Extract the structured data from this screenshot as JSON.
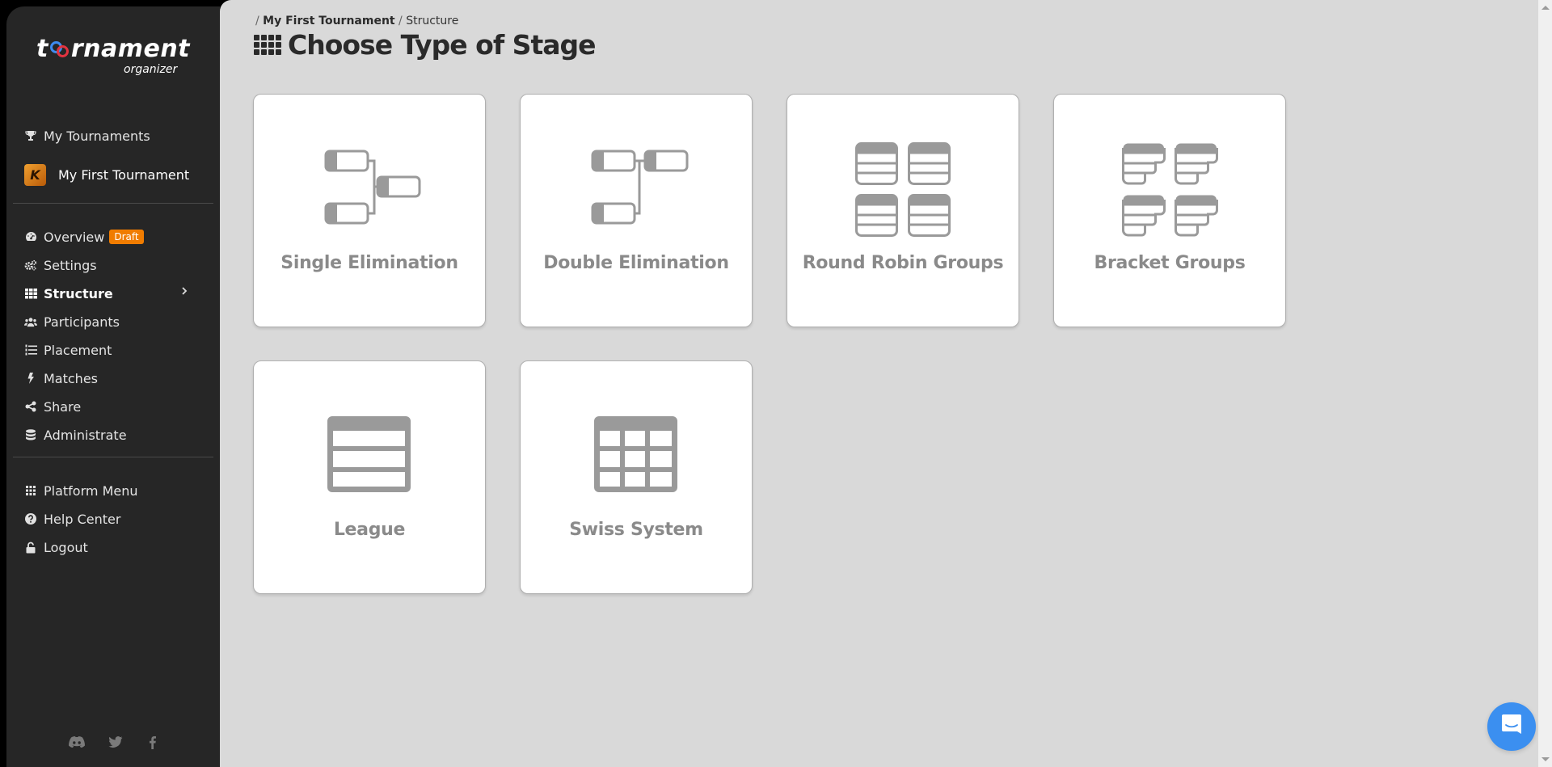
{
  "app": {
    "logo_main_left": "t",
    "logo_main_right": "rnament",
    "logo_sub": "organizer"
  },
  "sidebar": {
    "my_tournaments": "My Tournaments",
    "current_tournament": "My First Tournament",
    "tournament_avatar_glyph": "K",
    "items": [
      {
        "label": "Overview",
        "icon": "dashboard-icon",
        "badge": "Draft"
      },
      {
        "label": "Settings",
        "icon": "gears-icon"
      },
      {
        "label": "Structure",
        "icon": "grid-icon",
        "active": true
      },
      {
        "label": "Participants",
        "icon": "users-icon"
      },
      {
        "label": "Placement",
        "icon": "ordered-list-icon"
      },
      {
        "label": "Matches",
        "icon": "bolt-icon"
      },
      {
        "label": "Share",
        "icon": "share-icon"
      },
      {
        "label": "Administrate",
        "icon": "database-icon"
      }
    ],
    "footer_items": [
      {
        "label": "Platform Menu",
        "icon": "grid-small-icon"
      },
      {
        "label": "Help Center",
        "icon": "question-circle-icon"
      },
      {
        "label": "Logout",
        "icon": "unlock-icon"
      }
    ],
    "social": [
      "discord-icon",
      "twitter-icon",
      "facebook-icon"
    ],
    "badge_color": "#f07c00"
  },
  "breadcrumb": {
    "tournament": "My First Tournament",
    "current": "Structure"
  },
  "page": {
    "title": "Choose Type of Stage"
  },
  "stage_types": [
    {
      "label": "Single Elimination",
      "icon": "single-elimination-icon"
    },
    {
      "label": "Double Elimination",
      "icon": "double-elimination-icon"
    },
    {
      "label": "Round Robin Groups",
      "icon": "round-robin-groups-icon"
    },
    {
      "label": "Bracket Groups",
      "icon": "bracket-groups-icon"
    },
    {
      "label": "League",
      "icon": "league-icon"
    },
    {
      "label": "Swiss System",
      "icon": "swiss-system-icon"
    }
  ],
  "chat": {
    "icon": "chat-icon",
    "color": "#3b8ff0"
  }
}
